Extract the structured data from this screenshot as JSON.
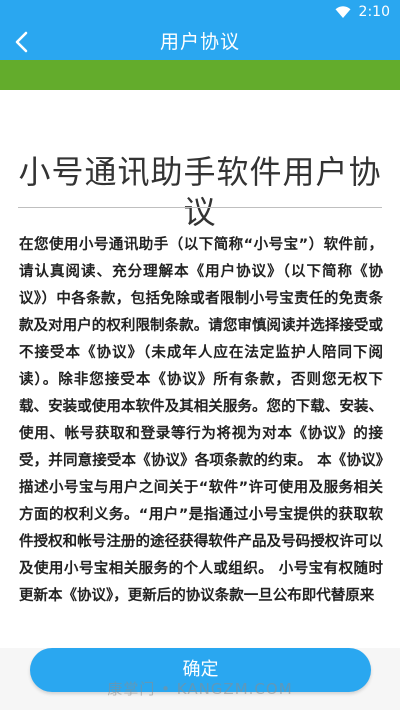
{
  "status_bar": {
    "time": "2:10",
    "wifi_icon": "wifi-icon"
  },
  "app_bar": {
    "title": "用户协议",
    "back_icon": "chevron-left-icon",
    "background_color": "#2aa7f0"
  },
  "accent_band_color": "#63ac2c",
  "document": {
    "title": "小号通讯助手软件用户协议",
    "body": "在您使用小号通讯助手（以下简称“小号宝”）软件前，请认真阅读、充分理解本《用户协议》（以下简称《协议》）中各条款，包括免除或者限制小号宝责任的免责条款及对用户的权利限制条款。请您审慎阅读并选择接受或不接受本《协议》（未成年人应在法定监护人陪同下阅读）。除非您接受本《协议》所有条款，否则您无权下载、安装或使用本软件及其相关服务。您的下载、安装、使用、帐号获取和登录等行为将视为对本《协议》的接受，并同意接受本《协议》各项条款的约束。 本《协议》描述小号宝与用户之间关于“软件”许可使用及服务相关方面的权利义务。“用户”是指通过小号宝提供的获取软件授权和帐号注册的途径获得软件产品及号码授权许可以及使用小号宝相关服务的个人或组织。 小号宝有权随时更新本《协议》，更新后的协议条款一旦公布即代替原来"
  },
  "confirm": {
    "label": "确定"
  },
  "watermark": {
    "text": "康掌门 • KANGZM.COM"
  }
}
